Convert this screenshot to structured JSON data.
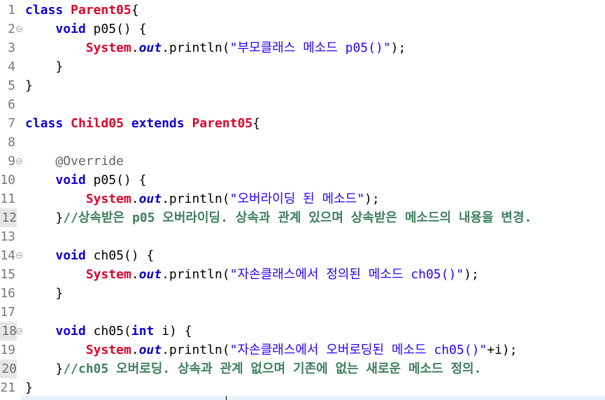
{
  "lines": [
    {
      "n": "1",
      "fold": false,
      "parts": [
        {
          "t": "class ",
          "c": "kw"
        },
        {
          "t": "Parent05",
          "c": "cls"
        },
        {
          "t": "{",
          "c": ""
        }
      ]
    },
    {
      "n": "2",
      "fold": true,
      "parts": [
        {
          "t": "    ",
          "c": ""
        },
        {
          "t": "void",
          "c": "kw"
        },
        {
          "t": " p05() {",
          "c": ""
        }
      ]
    },
    {
      "n": "3",
      "fold": false,
      "parts": [
        {
          "t": "        ",
          "c": ""
        },
        {
          "t": "System",
          "c": "cls"
        },
        {
          "t": ".",
          "c": ""
        },
        {
          "t": "out",
          "c": "field"
        },
        {
          "t": ".println(",
          "c": ""
        },
        {
          "t": "\"부모클래스 메소드 p05()\"",
          "c": "str"
        },
        {
          "t": ");",
          "c": ""
        }
      ]
    },
    {
      "n": "4",
      "fold": false,
      "parts": [
        {
          "t": "    }",
          "c": ""
        }
      ]
    },
    {
      "n": "5",
      "fold": false,
      "parts": [
        {
          "t": "}",
          "c": ""
        }
      ]
    },
    {
      "n": "6",
      "fold": false,
      "parts": []
    },
    {
      "n": "7",
      "fold": false,
      "parts": [
        {
          "t": "class ",
          "c": "kw"
        },
        {
          "t": "Child05",
          "c": "cls"
        },
        {
          "t": " ",
          "c": ""
        },
        {
          "t": "extends",
          "c": "kw"
        },
        {
          "t": " ",
          "c": ""
        },
        {
          "t": "Parent05",
          "c": "cls"
        },
        {
          "t": "{",
          "c": ""
        }
      ]
    },
    {
      "n": "8",
      "fold": false,
      "parts": []
    },
    {
      "n": "9",
      "fold": true,
      "parts": [
        {
          "t": "    ",
          "c": ""
        },
        {
          "t": "@Override",
          "c": "ann"
        }
      ]
    },
    {
      "n": "10",
      "fold": false,
      "parts": [
        {
          "t": "    ",
          "c": ""
        },
        {
          "t": "void",
          "c": "kw"
        },
        {
          "t": " p05() {",
          "c": ""
        }
      ]
    },
    {
      "n": "11",
      "fold": false,
      "parts": [
        {
          "t": "        ",
          "c": ""
        },
        {
          "t": "System",
          "c": "cls"
        },
        {
          "t": ".",
          "c": ""
        },
        {
          "t": "out",
          "c": "field"
        },
        {
          "t": ".println(",
          "c": ""
        },
        {
          "t": "\"오버라이딩 된 메소드\"",
          "c": "str"
        },
        {
          "t": ");",
          "c": ""
        }
      ]
    },
    {
      "n": "12",
      "fold": false,
      "hl": true,
      "parts": [
        {
          "t": "    }",
          "c": ""
        },
        {
          "t": "//상속받은 p05 오버라이딩. 상속과 관계 있으며 상속받은 메소드의 내용을 변경.",
          "c": "cmt"
        }
      ]
    },
    {
      "n": "13",
      "fold": false,
      "parts": []
    },
    {
      "n": "14",
      "fold": true,
      "parts": [
        {
          "t": "    ",
          "c": ""
        },
        {
          "t": "void",
          "c": "kw"
        },
        {
          "t": " ch05() {",
          "c": ""
        }
      ]
    },
    {
      "n": "15",
      "fold": false,
      "parts": [
        {
          "t": "        ",
          "c": ""
        },
        {
          "t": "System",
          "c": "cls"
        },
        {
          "t": ".",
          "c": ""
        },
        {
          "t": "out",
          "c": "field"
        },
        {
          "t": ".println(",
          "c": ""
        },
        {
          "t": "\"자손클래스에서 정의된 메소드 ch05()\"",
          "c": "str"
        },
        {
          "t": ");",
          "c": ""
        }
      ]
    },
    {
      "n": "16",
      "fold": false,
      "parts": [
        {
          "t": "    }",
          "c": ""
        }
      ]
    },
    {
      "n": "17",
      "fold": false,
      "parts": []
    },
    {
      "n": "18",
      "fold": true,
      "hl": true,
      "parts": [
        {
          "t": "    ",
          "c": ""
        },
        {
          "t": "void",
          "c": "kw"
        },
        {
          "t": " ch05(",
          "c": ""
        },
        {
          "t": "int",
          "c": "kw"
        },
        {
          "t": " i) {",
          "c": ""
        }
      ]
    },
    {
      "n": "19",
      "fold": false,
      "parts": [
        {
          "t": "        ",
          "c": ""
        },
        {
          "t": "System",
          "c": "cls"
        },
        {
          "t": ".",
          "c": ""
        },
        {
          "t": "out",
          "c": "field"
        },
        {
          "t": ".println(",
          "c": ""
        },
        {
          "t": "\"자손클래스에서 오버로딩된 메소드 ch05()\"",
          "c": "str"
        },
        {
          "t": "+i);",
          "c": ""
        }
      ]
    },
    {
      "n": "20",
      "fold": false,
      "hl": true,
      "parts": [
        {
          "t": "    }",
          "c": ""
        },
        {
          "t": "//ch05 오버로딩. 상속과 관계 없으며 기존에 없는 새로운 메소드 정의.",
          "c": "cmt"
        }
      ]
    },
    {
      "n": "21",
      "fold": false,
      "parts": [
        {
          "t": "}",
          "c": ""
        }
      ]
    }
  ]
}
